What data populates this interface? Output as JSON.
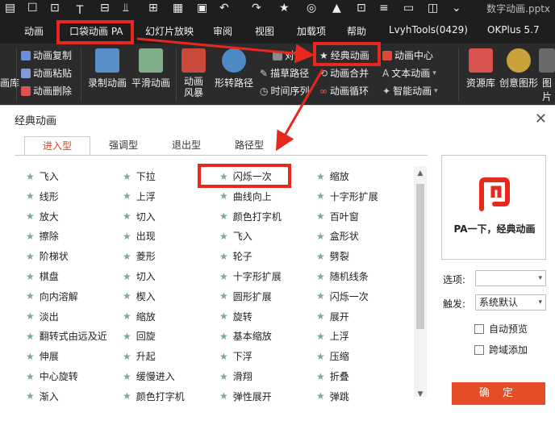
{
  "quick_access": {
    "doc_name": "数字动画.pptx"
  },
  "ribbon_tabs": [
    "动画",
    "口袋动画 PA",
    "幻灯片放映",
    "审阅",
    "视图",
    "加载项",
    "帮助",
    "LvyhTools(0429)",
    "OKPlus 5.7"
  ],
  "ribbon": {
    "left_items": [
      "动画复制",
      "动画粘贴",
      "动画删除"
    ],
    "left_cut": "画库",
    "big_buttons": [
      "录制动画",
      "平滑动画",
      "动画\n风暴",
      "形转路径"
    ],
    "mid_items": [
      "对齐",
      "描草路径",
      "时间序列"
    ],
    "group2": [
      "经典动画",
      "动画合并",
      "动画循环"
    ],
    "group3": [
      "动画中心",
      "文本动画",
      "智能动画"
    ],
    "right_big": [
      "资源库",
      "创意图形",
      "图片"
    ]
  },
  "dialog": {
    "title": "经典动画",
    "tabs": [
      "进入型",
      "强调型",
      "退出型",
      "路径型"
    ],
    "active_tab": "进入型",
    "columns": [
      [
        "飞入",
        "线形",
        "放大",
        "擦除",
        "阶梯状",
        "棋盘",
        "向内溶解",
        "淡出",
        "翻转式由远及近",
        "伸展",
        "中心旋转",
        "渐入"
      ],
      [
        "下拉",
        "上浮",
        "切入",
        "出现",
        "菱形",
        "切入",
        "楔入",
        "缩放",
        "回旋",
        "升起",
        "缓慢进入",
        "颜色打字机"
      ],
      [
        "闪烁一次",
        "曲线向上",
        "颜色打字机",
        "飞入",
        "轮子",
        "十字形扩展",
        "圆形扩展",
        "旋转",
        "基本缩放",
        "下浮",
        "滑翔",
        "弹性展开"
      ],
      [
        "缩放",
        "十字形扩展",
        "百叶窗",
        "盒形状",
        "劈裂",
        "随机线条",
        "闪烁一次",
        "展开",
        "上浮",
        "压缩",
        "折叠",
        "弹跳"
      ]
    ],
    "preview_text": "PA一下，经典动画",
    "option_label": "选项:",
    "option_value": "",
    "trigger_label": "触发:",
    "trigger_value": "系统默认",
    "checkbox_auto_preview": "自动预览",
    "checkbox_cross_add": "跨域添加",
    "ok_button": "确 定"
  },
  "colors": {
    "accent": "#e44d26",
    "highlight": "#e8271f",
    "ribbon_bg": "#2b2b2b",
    "star": "#7aa5a0"
  }
}
